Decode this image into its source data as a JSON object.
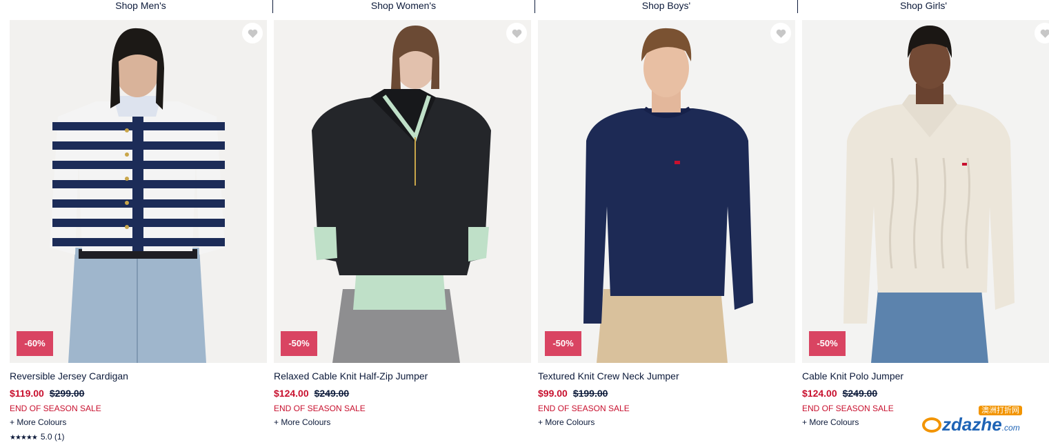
{
  "tabs": [
    "Shop Men's",
    "Shop Women's",
    "Shop Boys'",
    "Shop Girls'"
  ],
  "products": [
    {
      "name": "Reversible Jersey Cardigan",
      "discount": "-60%",
      "price": "$119.00",
      "was_price": "$299.00",
      "sale_label": "END OF SEASON SALE",
      "more_colours": "+ More Colours",
      "stars": "★★★★★",
      "rating": "5.0",
      "review_count": "(1)",
      "image": "woman-striped-cardigan"
    },
    {
      "name": "Relaxed Cable Knit Half-Zip Jumper",
      "discount": "-50%",
      "price": "$124.00",
      "was_price": "$249.00",
      "sale_label": "END OF SEASON SALE",
      "more_colours": "+ More Colours",
      "image": "woman-black-half-zip"
    },
    {
      "name": "Textured Knit Crew Neck Jumper",
      "discount": "-50%",
      "price": "$99.00",
      "was_price": "$199.00",
      "sale_label": "END OF SEASON SALE",
      "more_colours": "+ More Colours",
      "image": "man-navy-crew-neck"
    },
    {
      "name": "Cable Knit Polo Jumper",
      "discount": "-50%",
      "price": "$124.00",
      "was_price": "$249.00",
      "sale_label": "END OF SEASON SALE",
      "more_colours": "+ More Colours",
      "image": "man-cream-polo"
    }
  ],
  "watermark": {
    "top": "澳洲打折网",
    "main": "zdazhe",
    "suffix": ".com"
  },
  "colors": {
    "sale_red": "#c8102e",
    "badge": "#d94462",
    "navy": "#0c1a3a"
  },
  "icons": {
    "wishlist": "heart-icon",
    "rating": "star-icon"
  }
}
